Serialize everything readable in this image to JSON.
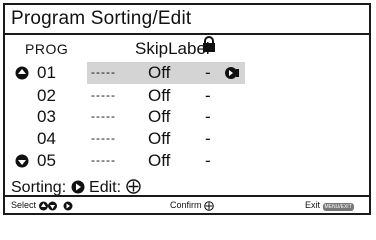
{
  "title": "Program Sorting/Edit",
  "header": {
    "prog": "PROG",
    "skip": "Skip",
    "label": "Label",
    "lock_icon": "lock-icon"
  },
  "rows": [
    {
      "num": "01",
      "label": "-----",
      "skip": "Off",
      "lock": "-",
      "selected": true,
      "marker": "up-arrow-icon",
      "action": "enter-icon"
    },
    {
      "num": "02",
      "label": "-----",
      "skip": "Off",
      "lock": "-"
    },
    {
      "num": "03",
      "label": "-----",
      "skip": "Off",
      "lock": "-"
    },
    {
      "num": "04",
      "label": "-----",
      "skip": "Off",
      "lock": "-"
    },
    {
      "num": "05",
      "label": "-----",
      "skip": "Off",
      "lock": "-",
      "marker": "down-arrow-icon"
    }
  ],
  "sorting": {
    "sorting_label": "Sorting:",
    "edit_label": "Edit:",
    "sorting_icon": "right-arrow-icon",
    "edit_icon": "cross-pad-icon"
  },
  "footer": {
    "select_label": "Select",
    "confirm_label": "Confirm",
    "exit_label": "Exit",
    "exit_button_text": "MENU/EXIT"
  },
  "colors": {
    "highlight": "#d4d4d4",
    "text": "#111111",
    "border": "#1a1a1a"
  }
}
